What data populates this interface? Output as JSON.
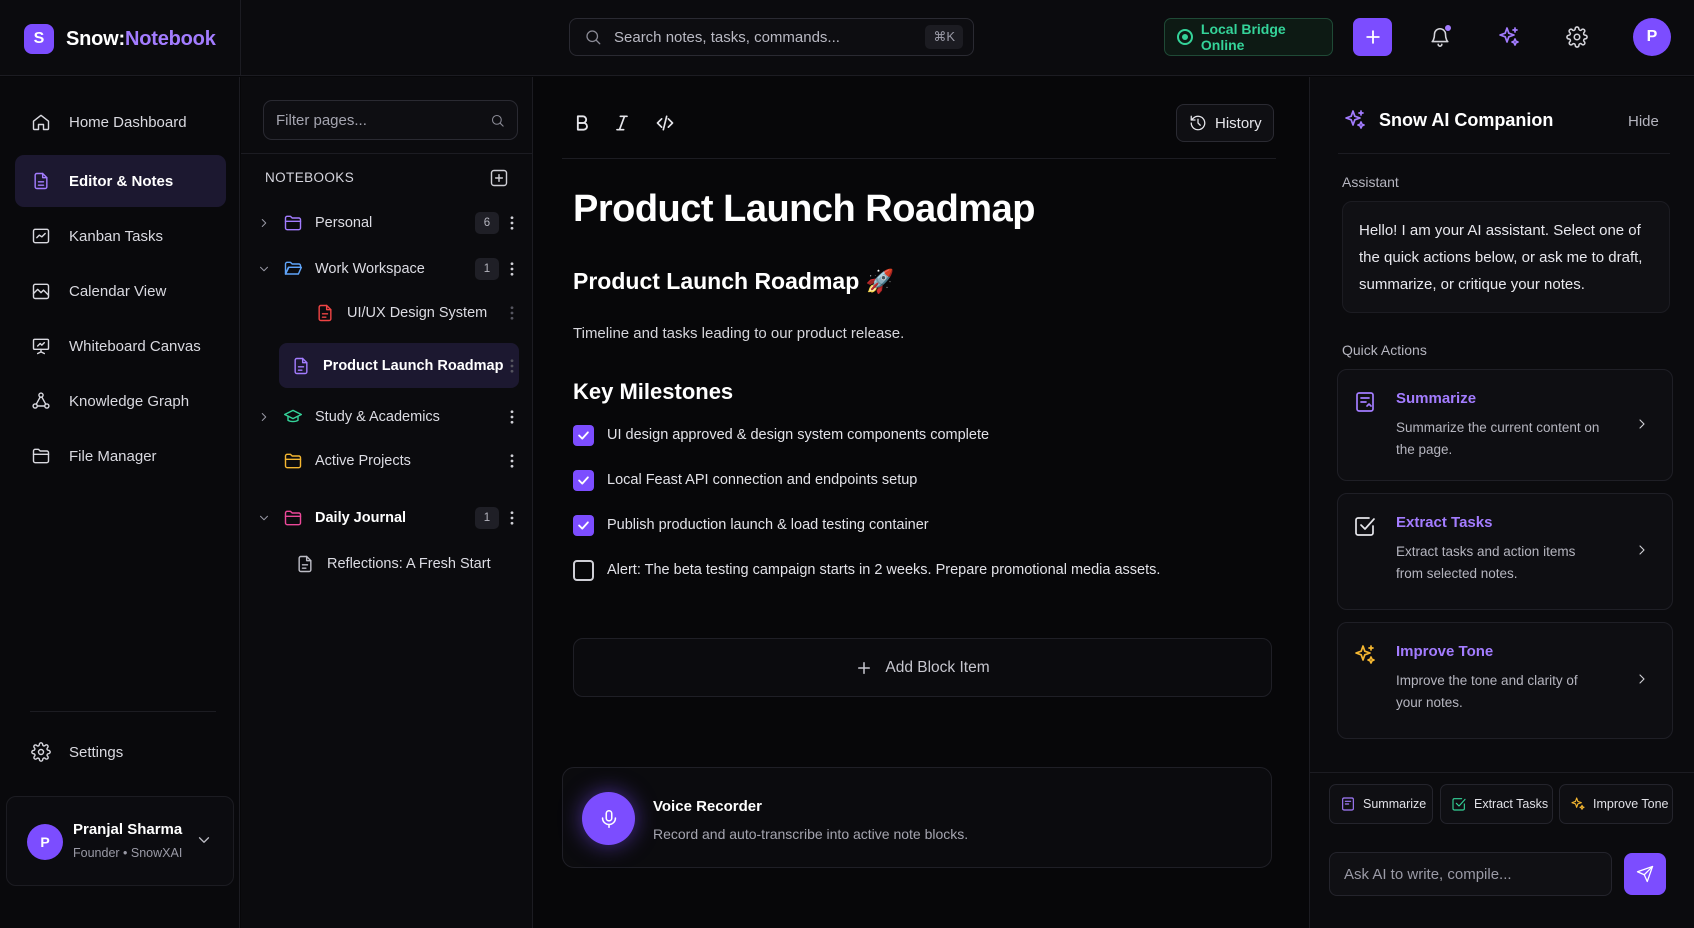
{
  "brand": {
    "logo_letter": "S",
    "name_part1": "Snow:",
    "name_part2": "Notebook"
  },
  "search": {
    "placeholder": "Search notes, tasks, commands...",
    "shortcut": "⌘K"
  },
  "status": {
    "label": "Local Bridge Online",
    "color": "#34d399"
  },
  "user": {
    "initial": "P",
    "name": "Pranjal Sharma",
    "role": "Founder • SnowXAI"
  },
  "sidebar": {
    "items": [
      {
        "label": "Home Dashboard",
        "icon": "home-icon"
      },
      {
        "label": "Editor & Notes",
        "icon": "file-text-icon",
        "active": true
      },
      {
        "label": "Kanban Tasks",
        "icon": "kanban-icon"
      },
      {
        "label": "Calendar View",
        "icon": "calendar-icon"
      },
      {
        "label": "Whiteboard Canvas",
        "icon": "presentation-icon"
      },
      {
        "label": "Knowledge Graph",
        "icon": "graph-icon"
      },
      {
        "label": "File Manager",
        "icon": "folder-icon"
      }
    ],
    "settings_label": "Settings"
  },
  "pages": {
    "filter_placeholder": "Filter pages...",
    "heading": "NOTEBOOKS",
    "tree": [
      {
        "label": "Personal",
        "count": "6",
        "icon": "folder-icon",
        "color": "#a37cff"
      },
      {
        "label": "Work Workspace",
        "count": "1",
        "icon": "folder-open-icon",
        "color": "#60a5fa"
      },
      {
        "label": "UI/UX Design System",
        "icon": "file-icon",
        "color": "#ef4444"
      },
      {
        "label": "Product Launch Roadmap",
        "icon": "file-icon",
        "color": "#a37cff",
        "active": true
      },
      {
        "label": "Study & Academics",
        "icon": "graduation-cap-icon",
        "color": "#34d399"
      },
      {
        "label": "Active Projects",
        "icon": "folder-icon",
        "color": "#f5b731"
      },
      {
        "label": "Daily Journal",
        "count": "1",
        "icon": "folder-icon",
        "color": "#ec4899"
      },
      {
        "label": "Reflections: A Fresh Start",
        "icon": "file-icon",
        "color": "#bdbdc6"
      }
    ]
  },
  "editor": {
    "history_label": "History",
    "title": "Product Launch Roadmap",
    "heading": "Product Launch Roadmap 🚀",
    "description": "Timeline and tasks leading to our product release.",
    "milestones_heading": "Key Milestones",
    "tasks": [
      {
        "text": "UI design approved & design system components complete",
        "done": true
      },
      {
        "text": "Local Feast API connection and endpoints setup",
        "done": true
      },
      {
        "text": "Publish production launch & load testing container",
        "done": true
      },
      {
        "text": "Alert: The beta testing campaign starts in 2 weeks. Prepare promotional media assets.",
        "done": false
      }
    ],
    "add_block_label": "Add Block Item",
    "voice": {
      "title": "Voice Recorder",
      "subtitle": "Record and auto-transcribe into active note blocks."
    }
  },
  "ai": {
    "title": "Snow AI Companion",
    "hide_label": "Hide",
    "assistant_label": "Assistant",
    "assistant_message": "Hello! I am your AI assistant. Select one of the quick actions below, or ask me to draft, summarize, or critique your notes.",
    "quick_actions_label": "Quick Actions",
    "actions": [
      {
        "title": "Summarize",
        "desc": "Summarize the current content on the page.",
        "icon": "summarize-icon",
        "color": "#a37cff"
      },
      {
        "title": "Extract Tasks",
        "desc": "Extract tasks and action items from selected notes.",
        "icon": "check-square-icon",
        "color": "#e5e5ea"
      },
      {
        "title": "Improve Tone",
        "desc": "Improve the tone and clarity of your notes.",
        "icon": "sparkles-icon",
        "color": "#f5b731"
      }
    ],
    "chips": [
      "Summarize",
      "Extract Tasks",
      "Improve Tone"
    ],
    "input_placeholder": "Ask AI to write, compile..."
  },
  "colors": {
    "accent": "#7c4dff",
    "accent_light": "#a37cff",
    "background": "#070709",
    "panel": "#0b0b0e"
  }
}
